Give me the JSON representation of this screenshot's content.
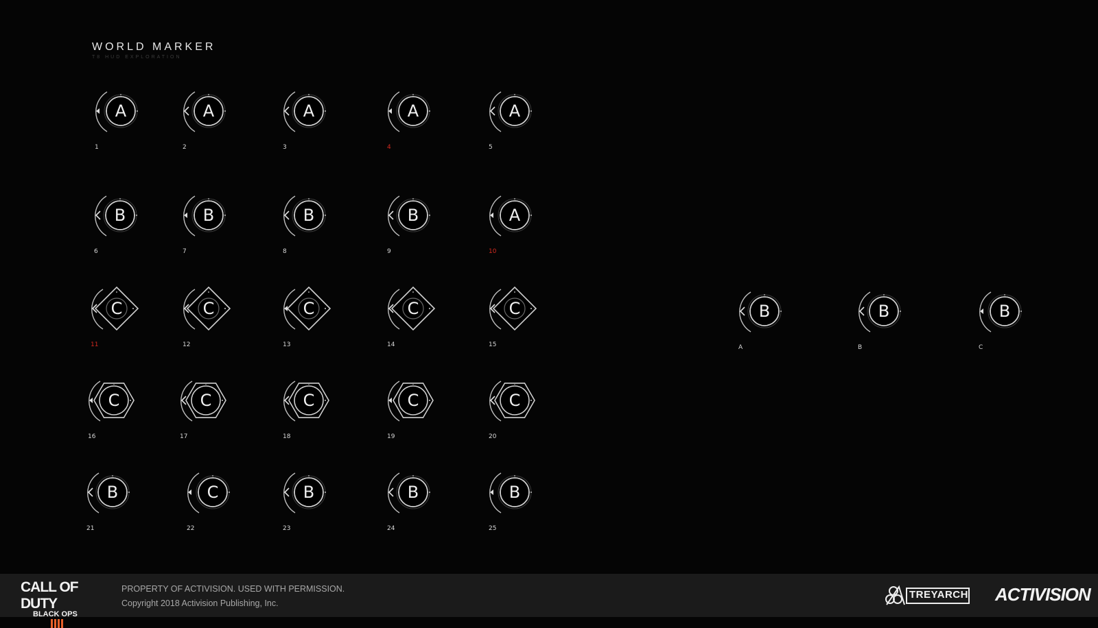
{
  "header": {
    "title": "WORLD MARKER",
    "subtitle": "T8 HUD EXPLORATION"
  },
  "markers_table": "id|letter|shape|label|red\nm01|A|circle|01|false\nm02|A|circle|02|false\nm03|A|circle|03|false\nm04|A|circle|04|true\nm05|A|circle|05|false\nm06|B|circle|06|false\nm07|B|circle|07|false\nm08|B|circle|08|false\nm09|B|circle|09|false\nm10|A|circle|10|true\nm11|C|diamond|11|true\nm12|C|diamond|12|false\nm13|C|diamond|13|false\nm14|C|diamond|14|false\nm15|C|diamond|15|false\nm16|C|hexagon|16|false\nm17|C|hexagon|17|false\nm18|C|hexagon|18|false\nm19|C|hexagon|19|false\nm20|C|hexagon|20|false\nm21|B|circle|21|false\nm22|C|circle|22|false\nm23|B|circle|23|false\nm24|B|circle|24|false\nm25|B|circle|25|false\nmA|B|circle|A|false\nmB|B|circle|B|false\nmC|B|circle|C|false",
  "footer": {
    "cod_logo_line1": "CALL OF DUTY",
    "cod_logo_line2": "BLACK OPS",
    "legal_line1": "PROPERTY OF ACTIVISION. USED WITH PERMISSION.",
    "legal_line2": "Copyright 2018 Activision Publishing, Inc.",
    "treyarch": "TREYARCH",
    "activision": "ACTIVISION"
  }
}
